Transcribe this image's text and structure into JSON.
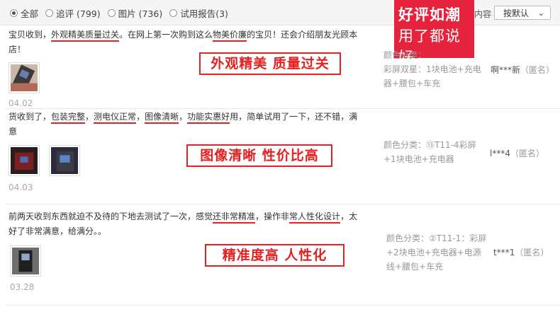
{
  "filters": {
    "all": "全部",
    "follow_up": "追评 (799)",
    "pictures": "图片 (736)",
    "trial_report": "试用报告(3)"
  },
  "content_label": "内容",
  "sort": {
    "label": "按默认"
  },
  "promo": {
    "line1": "好评如潮",
    "line2": "用了都说好"
  },
  "reviews": [
    {
      "text_a": "宝贝收到，",
      "text_u1": "外观精美质量过关",
      "text_b": "。在网上第一次购到这么",
      "text_u2": "物美价廉",
      "text_c": "的宝贝！还会介绍朋友光顾本店！",
      "stamp": "外观精美 质量过关",
      "date": "04.02",
      "sku_label": "颜色分类：",
      "sku": "彩屏双星：1块电池+充电器+腰包+车充",
      "user": "啊***新",
      "anon": "（匿名）"
    },
    {
      "text_a": "货收到了，",
      "text_u1": "包装完整",
      "text_sep1": "，",
      "text_u2": "测电仪正常",
      "text_sep2": "，",
      "text_u3": "图像清晰",
      "text_sep3": "，",
      "text_u4": "功能实惠好",
      "text_b": "用，简单试用了一下，还不错，满意",
      "stamp": "图像清晰 性价比高",
      "date": "04.03",
      "sku": "颜色分类：⑬T11-4彩屏+1块电池+充电器",
      "user": "l***4",
      "anon": "（匿名）"
    },
    {
      "text_a": "前两天收到东西就迫不及待的下地去测试了一次，感觉",
      "text_u1": "还非常精准",
      "text_b": "，操作非",
      "text_u2": "常人性化设计",
      "text_c": "，太好了非常满意，给满分。。",
      "stamp": "精准度高 人性化",
      "date": "03.28",
      "sku": "颜色分类：②T11-1：彩屏+2块电池+充电器+电源线+腰包+车充",
      "user": "t***1",
      "anon": "（匿名）"
    }
  ]
}
